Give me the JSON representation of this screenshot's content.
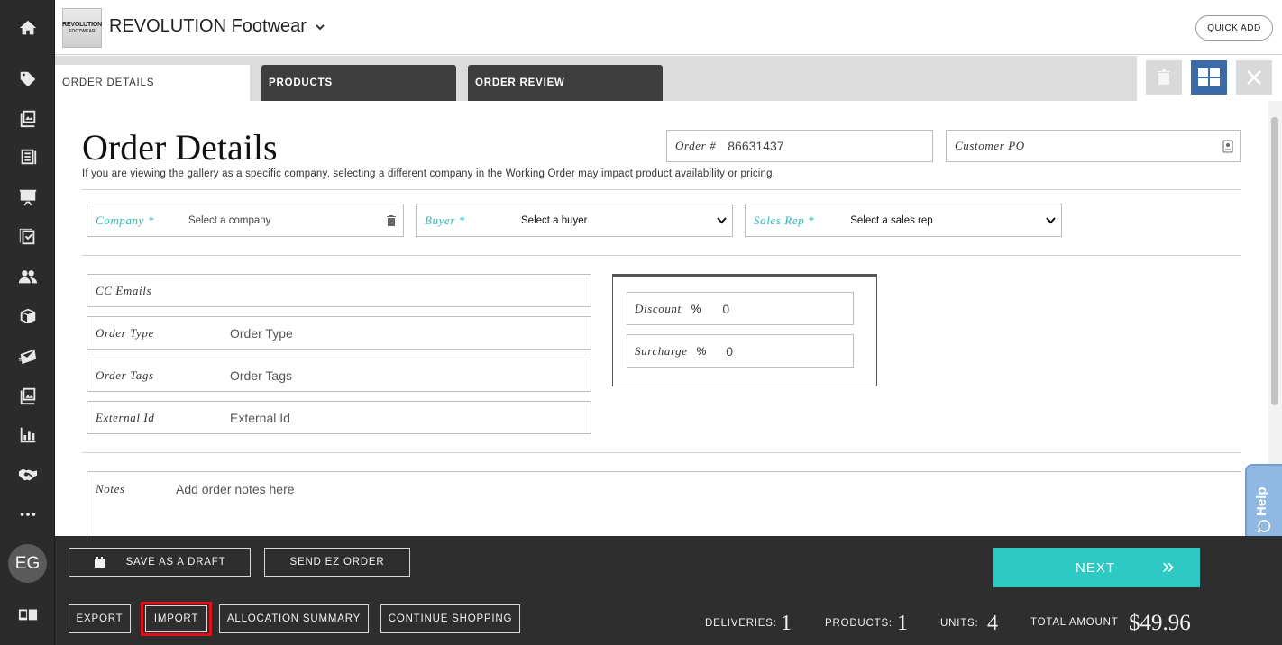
{
  "header": {
    "company": "REVOLUTION Footwear",
    "logo_line1": "REVOLUTION",
    "logo_line2": "FOOTWEAR",
    "quick_add": "QUICK ADD"
  },
  "sidebar": {
    "icons": [
      "home-icon",
      "tag-icon",
      "gallery-icon",
      "catalog-icon",
      "presentation-icon",
      "checklist-icon",
      "users-icon",
      "box-icon",
      "mail-icon",
      "image-icon",
      "chart-icon",
      "handshake-icon",
      "more-icon"
    ],
    "avatar": "EG"
  },
  "tabs": [
    {
      "label": "ORDER DETAILS",
      "active": true
    },
    {
      "label": "PRODUCTS",
      "active": false
    },
    {
      "label": "ORDER REVIEW",
      "active": false
    }
  ],
  "main": {
    "title": "Order Details",
    "description": "If you are viewing the gallery as a specific company, selecting a different company in the Working Order may impact product availability or pricing.",
    "order_number_label": "Order #",
    "order_number": "86631437",
    "customer_po_label": "Customer PO",
    "company_label": "Company *",
    "company_placeholder": "Select a company",
    "buyer_label": "Buyer *",
    "buyer_value": "Select a buyer",
    "sales_rep_label": "Sales Rep *",
    "sales_rep_value": "Select a sales rep",
    "cc_emails_label": "CC Emails",
    "order_type_label": "Order Type",
    "order_type_placeholder": "Order Type",
    "order_tags_label": "Order Tags",
    "order_tags_placeholder": "Order Tags",
    "external_id_label": "External Id",
    "external_id_placeholder": "External Id",
    "discount_label": "Discount",
    "discount_unit": "%",
    "discount_value": "0",
    "surcharge_label": "Surcharge",
    "surcharge_unit": "%",
    "surcharge_value": "0",
    "notes_label": "Notes",
    "notes_placeholder": "Add order notes here"
  },
  "help": {
    "label": "Help"
  },
  "footer": {
    "save_draft": "SAVE AS A DRAFT",
    "send_ez": "SEND EZ ORDER",
    "export": "EXPORT",
    "import": "IMPORT",
    "allocation": "ALLOCATION SUMMARY",
    "continue": "CONTINUE SHOPPING",
    "next": "NEXT",
    "next_arrow": "»",
    "deliveries_label": "DELIVERIES:",
    "deliveries": "1",
    "products_label": "PRODUCTS:",
    "products": "1",
    "units_label": "UNITS:",
    "units": "4",
    "total_label": "TOTAL AMOUNT",
    "total": "$49.96"
  },
  "colors": {
    "accent_teal": "#2ec9c3",
    "sidebar_bg": "#2b2b2b",
    "footer_bg": "#2e2e2e",
    "grid_button": "#3b6aa6",
    "highlight_red": "#e0101a"
  }
}
